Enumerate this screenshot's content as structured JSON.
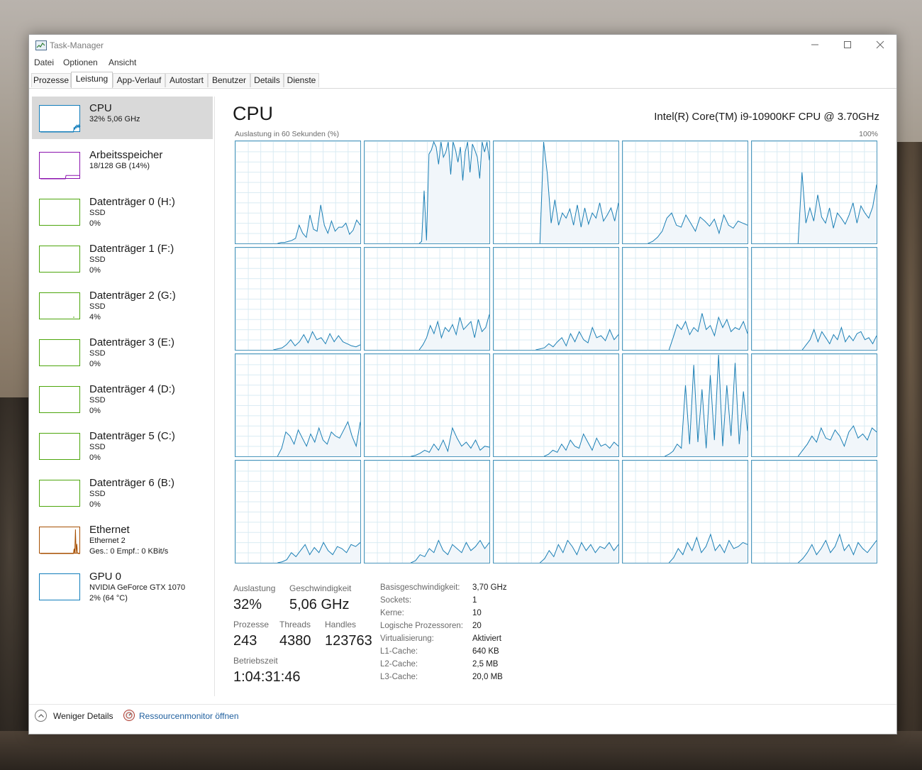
{
  "window": {
    "title": "Task-Manager"
  },
  "menu": [
    "Datei",
    "Optionen",
    "Ansicht"
  ],
  "tabs": [
    "Prozesse",
    "Leistung",
    "App-Verlauf",
    "Autostart",
    "Benutzer",
    "Details",
    "Dienste"
  ],
  "active_tab": "Leistung",
  "sidebar": [
    {
      "title": "CPU",
      "lines": [
        "32%  5,06 GHz"
      ],
      "color": "#117dbb",
      "selected": true
    },
    {
      "title": "Arbeitsspeicher",
      "lines": [
        "18/128 GB (14%)"
      ],
      "color": "#8b12ae"
    },
    {
      "title": "Datenträger 0 (H:)",
      "lines": [
        "SSD",
        "0%"
      ],
      "color": "#4da60c"
    },
    {
      "title": "Datenträger 1 (F:)",
      "lines": [
        "SSD",
        "0%"
      ],
      "color": "#4da60c"
    },
    {
      "title": "Datenträger 2 (G:)",
      "lines": [
        "SSD",
        "4%"
      ],
      "color": "#4da60c"
    },
    {
      "title": "Datenträger 3 (E:)",
      "lines": [
        "SSD",
        "0%"
      ],
      "color": "#4da60c"
    },
    {
      "title": "Datenträger 4 (D:)",
      "lines": [
        "SSD",
        "0%"
      ],
      "color": "#4da60c"
    },
    {
      "title": "Datenträger 5 (C:)",
      "lines": [
        "SSD",
        "0%"
      ],
      "color": "#4da60c"
    },
    {
      "title": "Datenträger 6 (B:)",
      "lines": [
        "SSD",
        "0%"
      ],
      "color": "#4da60c"
    },
    {
      "title": "Ethernet",
      "lines": [
        "Ethernet 2",
        "Ges.: 0 Empf.: 0 KBit/s"
      ],
      "color": "#a74f01"
    },
    {
      "title": "GPU 0",
      "lines": [
        "NVIDIA GeForce GTX 1070",
        "2%  (64 °C)"
      ],
      "color": "#117dbb"
    }
  ],
  "main": {
    "title": "CPU",
    "model": "Intel(R) Core(TM) i9-10900KF CPU @ 3.70GHz",
    "chart_label": "Auslastung in 60 Sekunden (%)",
    "chart_max": "100%"
  },
  "stats": {
    "auslastung_label": "Auslastung",
    "auslastung": "32%",
    "geschwindigkeit_label": "Geschwindigkeit",
    "geschwindigkeit": "5,06 GHz",
    "prozesse_label": "Prozesse",
    "prozesse": "243",
    "threads_label": "Threads",
    "threads": "4380",
    "handles_label": "Handles",
    "handles": "123763",
    "betriebszeit_label": "Betriebszeit",
    "betriebszeit": "1:04:31:46"
  },
  "info": [
    {
      "label": "Basisgeschwindigkeit:",
      "value": "3,70 GHz"
    },
    {
      "label": "Sockets:",
      "value": "1"
    },
    {
      "label": "Kerne:",
      "value": "10"
    },
    {
      "label": "Logische Prozessoren:",
      "value": "20"
    },
    {
      "label": "Virtualisierung:",
      "value": "Aktiviert"
    },
    {
      "label": "L1-Cache:",
      "value": "640 KB"
    },
    {
      "label": "L2-Cache:",
      "value": "2,5 MB"
    },
    {
      "label": "L3-Cache:",
      "value": "20,0 MB"
    }
  ],
  "footer": {
    "less_details": "Weniger Details",
    "resource_monitor": "Ressourcenmonitor öffnen"
  },
  "colors": {
    "cpu_line": "#1b7fb5",
    "cpu_fill": "#f1f6fa",
    "grid_line": "#d9ebf3"
  },
  "chart_data": {
    "type": "line",
    "title": "Auslastung in 60 Sekunden (%)",
    "ylim": [
      0,
      100
    ],
    "cores": [
      {
        "start": 20,
        "values": [
          0,
          1,
          1,
          2,
          3,
          5,
          18,
          10,
          6,
          28,
          14,
          12,
          38,
          18,
          10,
          22,
          12,
          16,
          16,
          20,
          9,
          13,
          23,
          18
        ]
      },
      {
        "start": 26,
        "values": [
          0,
          2,
          52,
          3,
          88,
          92,
          100,
          95,
          78,
          100,
          85,
          90,
          100,
          68,
          100,
          92,
          80,
          95,
          62,
          90,
          100,
          70,
          98,
          92,
          85,
          64,
          100,
          90,
          100,
          82
        ]
      },
      {
        "start": 22,
        "values": [
          0,
          100,
          68,
          20,
          43,
          18,
          30,
          25,
          34,
          18,
          38,
          16,
          35,
          19,
          30,
          25,
          40,
          22,
          28,
          35,
          22,
          40
        ]
      },
      {
        "start": 12,
        "values": [
          0,
          2,
          6,
          12,
          25,
          30,
          18,
          16,
          28,
          20,
          12,
          26,
          22,
          17,
          24,
          10,
          28,
          18,
          15,
          22,
          20,
          18
        ]
      },
      {
        "start": 22,
        "values": [
          0,
          70,
          20,
          35,
          22,
          48,
          26,
          20,
          35,
          15,
          30,
          25,
          19,
          28,
          40,
          20,
          37,
          30,
          25,
          36,
          58
        ]
      },
      {
        "start": 18,
        "values": [
          0,
          1,
          2,
          5,
          10,
          4,
          8,
          15,
          7,
          18,
          10,
          12,
          6,
          16,
          8,
          14,
          8,
          6,
          4,
          3,
          5
        ]
      },
      {
        "start": 26,
        "values": [
          0,
          5,
          12,
          24,
          16,
          28,
          12,
          22,
          18,
          25,
          15,
          32,
          20,
          24,
          28,
          12,
          30,
          18,
          22,
          35
        ]
      },
      {
        "start": 20,
        "values": [
          0,
          1,
          2,
          6,
          3,
          8,
          12,
          4,
          16,
          8,
          18,
          10,
          7,
          22,
          12,
          14,
          9,
          20,
          10,
          15
        ]
      },
      {
        "start": 22,
        "values": [
          0,
          12,
          25,
          20,
          28,
          15,
          22,
          18,
          36,
          20,
          24,
          14,
          32,
          22,
          30,
          18,
          22,
          20,
          28,
          16
        ]
      },
      {
        "start": 24,
        "values": [
          0,
          5,
          10,
          20,
          8,
          18,
          12,
          6,
          15,
          10,
          22,
          8,
          14,
          9,
          16,
          18,
          10,
          12,
          6,
          14
        ]
      },
      {
        "start": 20,
        "values": [
          0,
          8,
          24,
          20,
          12,
          26,
          18,
          10,
          22,
          14,
          28,
          16,
          12,
          24,
          20,
          18,
          26,
          34,
          20,
          10,
          34
        ]
      },
      {
        "start": 22,
        "values": [
          0,
          1,
          3,
          6,
          4,
          12,
          6,
          16,
          5,
          28,
          18,
          10,
          14,
          8,
          16,
          6,
          10,
          9
        ]
      },
      {
        "start": 24,
        "values": [
          0,
          2,
          6,
          4,
          12,
          6,
          16,
          10,
          8,
          22,
          14,
          6,
          18,
          10,
          12,
          8,
          14,
          10
        ]
      },
      {
        "start": 20,
        "values": [
          0,
          2,
          5,
          12,
          8,
          70,
          12,
          90,
          14,
          66,
          8,
          80,
          16,
          100,
          10,
          70,
          20,
          92,
          12,
          64,
          25
        ]
      },
      {
        "start": 22,
        "values": [
          0,
          6,
          12,
          20,
          14,
          28,
          18,
          16,
          26,
          20,
          10,
          24,
          30,
          18,
          22,
          16,
          28,
          24
        ]
      },
      {
        "start": 20,
        "values": [
          0,
          1,
          3,
          10,
          6,
          12,
          18,
          8,
          15,
          10,
          20,
          12,
          8,
          16,
          14,
          10,
          18,
          16,
          20
        ]
      },
      {
        "start": 22,
        "values": [
          0,
          2,
          8,
          6,
          14,
          10,
          22,
          12,
          8,
          18,
          14,
          10,
          20,
          12,
          16,
          22,
          14,
          20
        ]
      },
      {
        "start": 22,
        "values": [
          0,
          4,
          12,
          6,
          18,
          10,
          22,
          16,
          8,
          20,
          12,
          18,
          10,
          16,
          14,
          20,
          12,
          18
        ]
      },
      {
        "start": 22,
        "values": [
          0,
          5,
          14,
          8,
          20,
          12,
          25,
          10,
          16,
          28,
          12,
          18,
          10,
          22,
          14,
          16,
          20,
          18
        ]
      },
      {
        "start": 22,
        "values": [
          0,
          4,
          10,
          18,
          8,
          14,
          22,
          10,
          16,
          28,
          12,
          18,
          8,
          20,
          14,
          10,
          16,
          22
        ]
      }
    ]
  }
}
